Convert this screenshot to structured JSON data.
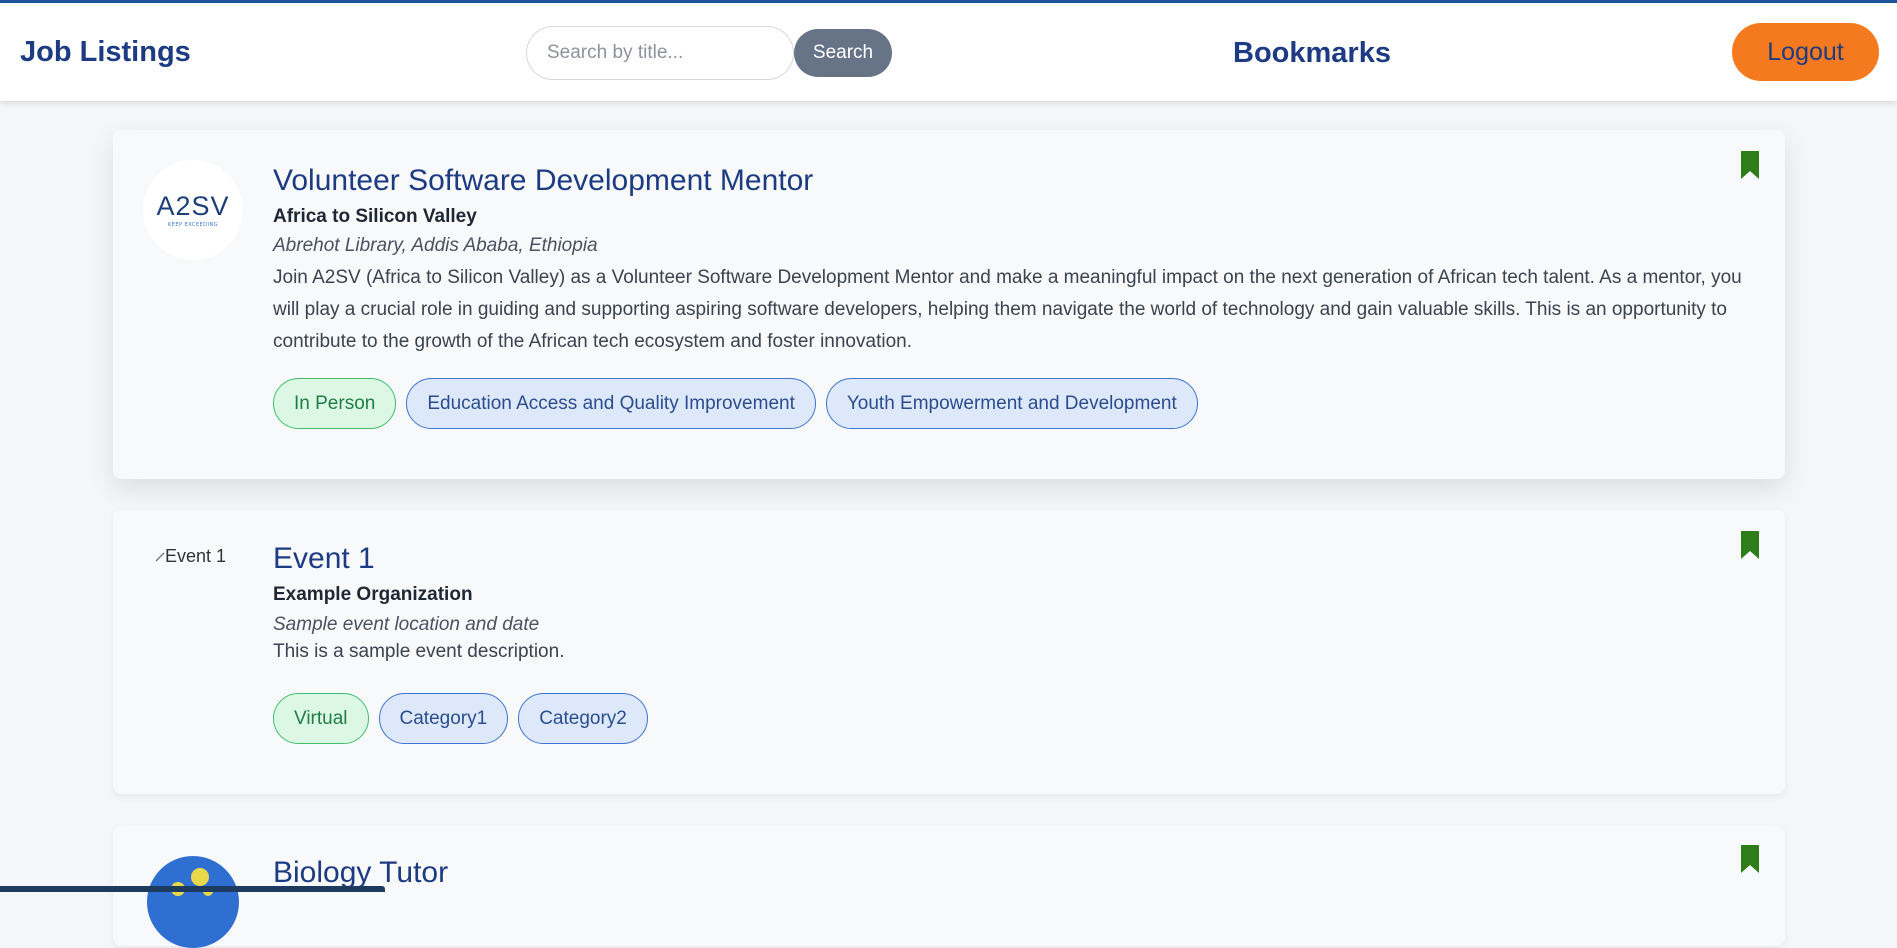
{
  "navbar": {
    "brand": "Job Listings",
    "search_placeholder": "Search by title...",
    "search_button": "Search",
    "bookmarks": "Bookmarks",
    "logout": "Logout"
  },
  "colors": {
    "brand": "#1c3b83",
    "logout": "#f57a1f",
    "bookmark": "#2e7d1a",
    "search_button": "#677488"
  },
  "listings": [
    {
      "logo": {
        "text": "A2SV",
        "subtext": "KEEP EXCEEDING"
      },
      "title": "Volunteer Software Development Mentor",
      "organization": "Africa to Silicon Valley",
      "location": "Abrehot Library, Addis Ababa, Ethiopia",
      "description": "Join A2SV (Africa to Silicon Valley) as a Volunteer Software Development Mentor and make a meaningful impact on the next generation of African tech talent. As a mentor, you will play a crucial role in guiding and supporting aspiring software developers, helping them navigate the world of technology and gain valuable skills. This is an opportunity to contribute to the growth of the African tech ecosystem and foster innovation.",
      "tags": [
        "In Person",
        "Education Access and Quality Improvement",
        "Youth Empowerment and Development"
      ],
      "bookmark_icon": "bookmark-filled-icon"
    },
    {
      "logo_alt": "Event 1",
      "title": "Event 1",
      "organization": "Example Organization",
      "location": "Sample event location and date",
      "description": "This is a sample event description.",
      "tags": [
        "Virtual",
        "Category1",
        "Category2"
      ],
      "bookmark_icon": "bookmark-filled-icon"
    },
    {
      "title": "Biology Tutor",
      "bookmark_icon": "bookmark-filled-icon"
    }
  ]
}
